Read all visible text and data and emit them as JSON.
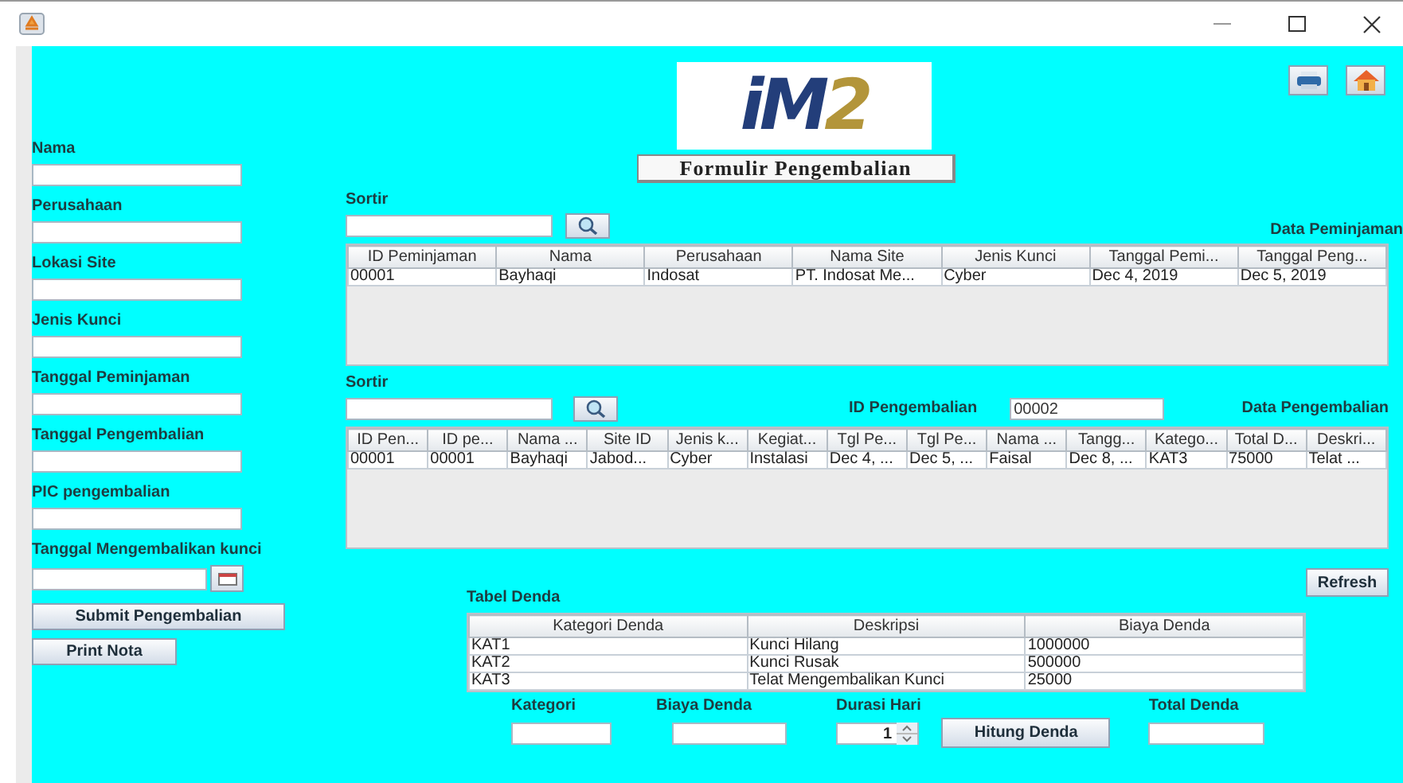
{
  "logo": {
    "text": "iM",
    "accent": "2"
  },
  "title": "Formulir Pengembalian",
  "form": {
    "fields": [
      {
        "label": "Nama",
        "kind": "text"
      },
      {
        "label": "Perusahaan",
        "kind": "text"
      },
      {
        "label": "Lokasi Site",
        "kind": "text"
      },
      {
        "label": "Jenis Kunci",
        "kind": "text"
      },
      {
        "label": "Tanggal Peminjaman",
        "kind": "text"
      },
      {
        "label": "Tanggal Pengembalian",
        "kind": "text"
      },
      {
        "label": "PIC pengembalian",
        "kind": "text"
      },
      {
        "label": "Tanggal Mengembalikan kunci",
        "kind": "date"
      }
    ],
    "buttons": [
      "Submit Pengembalian",
      "Print Nota"
    ]
  },
  "peminjaman": {
    "sort_label": "Sortir",
    "heading": "Data Peminjaman",
    "table": {
      "columns": [
        "ID Peminjaman",
        "Nama",
        "Perusahaan",
        "Nama Site",
        "Jenis Kunci",
        "Tanggal Pemi...",
        "Tanggal Peng..."
      ],
      "rows": [
        [
          "00001",
          "Bayhaqi",
          "Indosat",
          "PT. Indosat Me...",
          "Cyber",
          "Dec 4, 2019",
          "Dec 5, 2019"
        ]
      ]
    }
  },
  "pengembalian": {
    "sort_label": "Sortir",
    "id_label": "ID Pengembalian",
    "id_value": "00002",
    "heading": "Data Pengembalian",
    "table": {
      "columns": [
        "ID Pen...",
        "ID pe...",
        "Nama ...",
        "Site ID",
        "Jenis k...",
        "Kegiat...",
        "Tgl Pe...",
        "Tgl Pe...",
        "Nama ...",
        "Tangg...",
        "Katego...",
        "Total D...",
        "Deskri..."
      ],
      "rows": [
        [
          "00001",
          "00001",
          "Bayhaqi",
          "Jabod...",
          "Cyber",
          "Instalasi",
          "Dec 4, ...",
          "Dec 5, ...",
          "Faisal",
          "Dec 8, ...",
          "KAT3",
          "75000",
          "Telat ..."
        ]
      ]
    }
  },
  "refresh_button": "Refresh",
  "denda": {
    "title": "Tabel Denda",
    "table": {
      "columns": [
        "Kategori Denda",
        "Deskripsi",
        "Biaya Denda"
      ],
      "rows": [
        [
          "KAT1",
          "Kunci Hilang",
          "1000000"
        ],
        [
          "KAT2",
          "Kunci Rusak",
          "500000"
        ],
        [
          "KAT3",
          "Telat Mengembalikan Kunci",
          "25000"
        ]
      ]
    },
    "kategori_label": "Kategori",
    "biaya_label": "Biaya Denda",
    "durasi_label": "Durasi Hari",
    "durasi_value": "1",
    "hitung_button": "Hitung Denda",
    "total_label": "Total Denda"
  }
}
